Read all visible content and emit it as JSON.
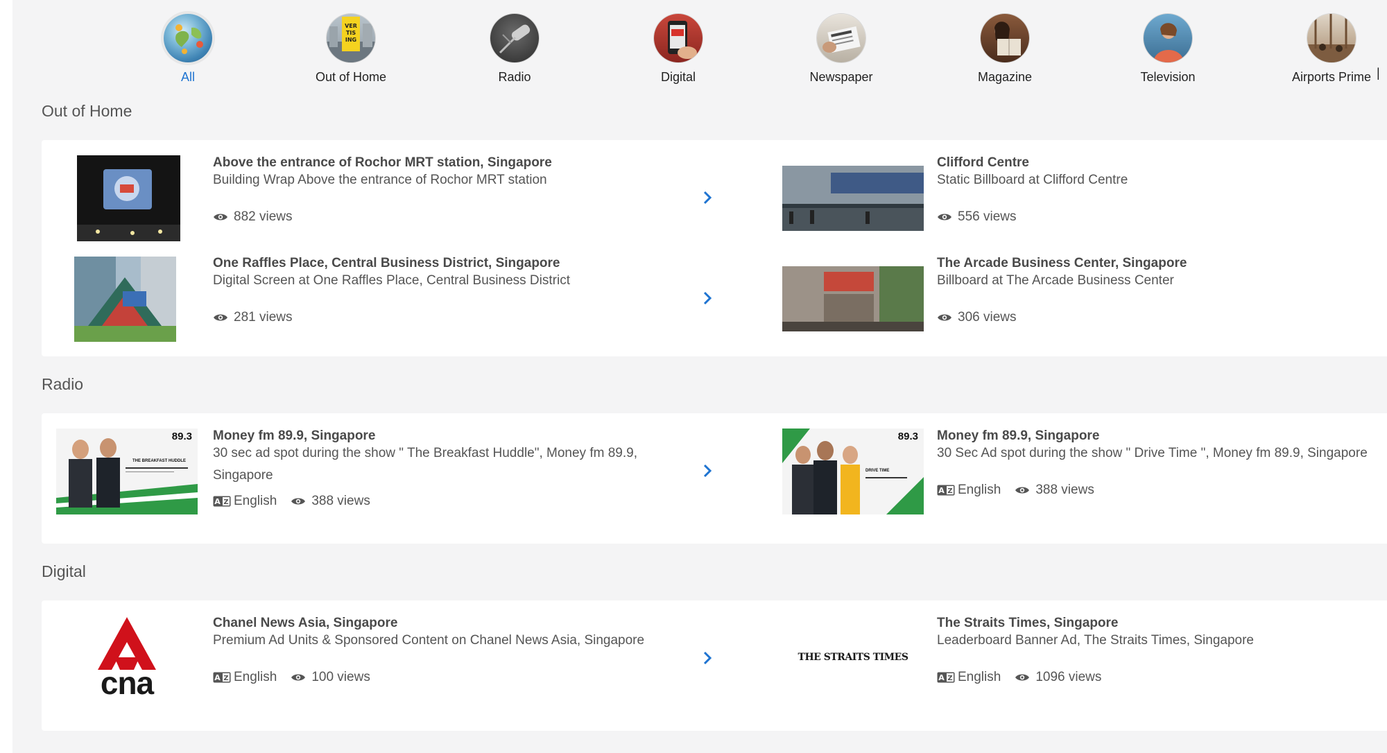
{
  "categories": [
    {
      "label": "All",
      "icon": "globe-icon",
      "active": true
    },
    {
      "label": "Out of Home",
      "icon": "billboard-icon"
    },
    {
      "label": "Radio",
      "icon": "microphone-icon"
    },
    {
      "label": "Digital",
      "icon": "phone-icon"
    },
    {
      "label": "Newspaper",
      "icon": "newspaper-icon"
    },
    {
      "label": "Magazine",
      "icon": "magazine-reader-icon"
    },
    {
      "label": "Television",
      "icon": "tv-viewer-icon"
    },
    {
      "label": "Airports Prime",
      "icon": "airport-icon"
    }
  ],
  "sections": {
    "ooh": {
      "title": "Out of Home",
      "items": [
        {
          "title": "Above the entrance of Rochor MRT station, Singapore",
          "subtitle": "Building Wrap Above the entrance of Rochor MRT station",
          "views": "882 views"
        },
        {
          "title": "Clifford Centre",
          "subtitle": "Static Billboard at Clifford Centre",
          "views": "556 views"
        },
        {
          "title": "One Raffles Place, Central Business District, Singapore",
          "subtitle": "Digital Screen at One Raffles Place, Central Business District",
          "views": "281 views"
        },
        {
          "title": "The Arcade Business Center, Singapore",
          "subtitle": "Billboard at The Arcade Business Center",
          "views": "306 views"
        }
      ]
    },
    "radio": {
      "title": "Radio",
      "items": [
        {
          "title": "Money fm 89.9, Singapore",
          "subtitle": "30 sec ad spot during the show \" The Breakfast Huddle\", Money fm 89.9, Singapore",
          "language": "English",
          "views": "388 views",
          "thumb_brand": "89.3",
          "thumb_show": "THE BREAKFAST HUDDLE"
        },
        {
          "title": "Money fm 89.9, Singapore",
          "subtitle": "30 Sec Ad spot during the show \" Drive Time \", Money fm 89.9, Singapore",
          "language": "English",
          "views": "388 views",
          "thumb_brand": "89.3",
          "thumb_show": "DRIVE TIME"
        }
      ]
    },
    "digital": {
      "title": "Digital",
      "items": [
        {
          "title": "Chanel News Asia, Singapore",
          "subtitle": "Premium Ad Units & Sponsored Content on Chanel News Asia, Singapore",
          "language": "English",
          "views": "100 views",
          "logo_text": "cna"
        },
        {
          "title": "The Straits Times, Singapore",
          "subtitle": "Leaderboard Banner Ad, The Straits Times, Singapore",
          "language": "English",
          "views": "1096 views",
          "logo_text": "THE STRAITS TIMES"
        }
      ]
    }
  },
  "colors": {
    "accent": "#1f74d1",
    "cna_red": "#d0111b",
    "money_green": "#2f9a46"
  }
}
